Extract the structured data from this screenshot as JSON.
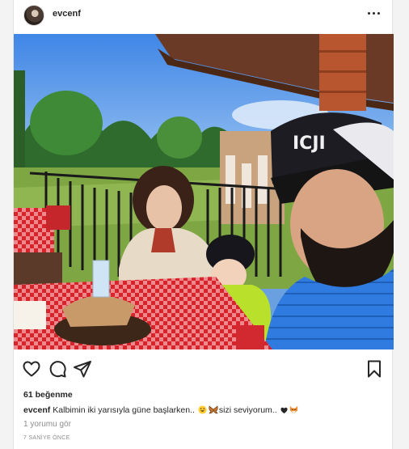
{
  "post": {
    "username": "evcenf",
    "likes": "61 beğenme",
    "caption_user": "evcenf",
    "caption_part1": "Kalbimin iki yarısıyla güne başlarken..",
    "caption_part2": "sizi seviyorum..",
    "view_comments": "1 yorumu gör",
    "timestamp": "7 SANİYE ÖNCE"
  },
  "photo": {
    "cap_text": "ICJI"
  },
  "icons": {
    "more": "more-horizontal-icon",
    "like": "heart-icon",
    "comment": "comment-bubble-icon",
    "share": "paper-plane-icon",
    "save": "bookmark-icon"
  },
  "colors": {
    "text": "#262626",
    "secondary": "#8e8e8e",
    "background": "#ffffff"
  }
}
